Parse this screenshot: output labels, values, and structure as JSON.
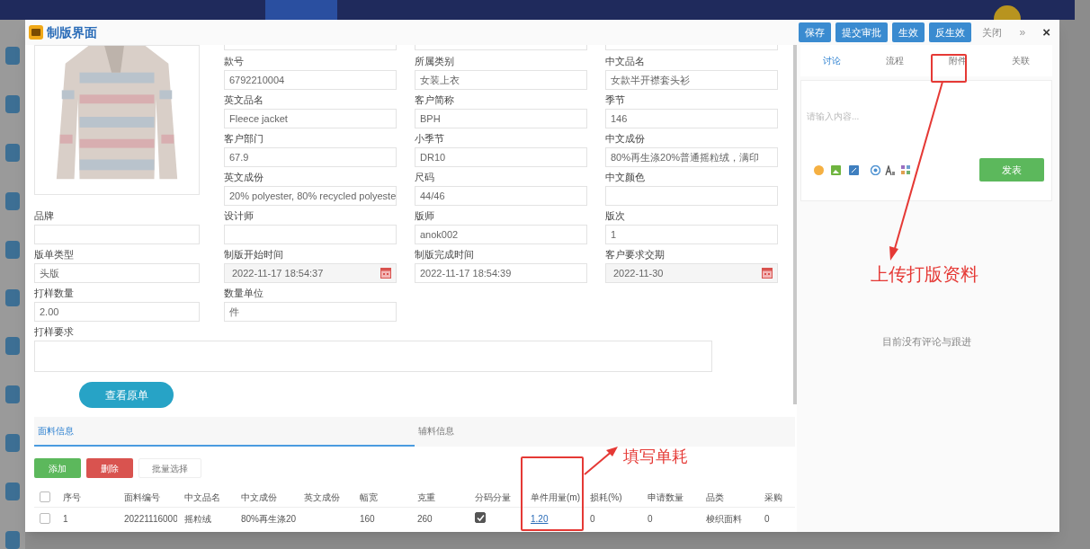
{
  "window": {
    "title": "制版界面"
  },
  "toolbar": {
    "buttons": [
      {
        "label": "保存",
        "kind": "primary"
      },
      {
        "label": "提交审批",
        "kind": "primary"
      },
      {
        "label": "生效",
        "kind": "primary"
      },
      {
        "label": "反生效",
        "kind": "primary"
      },
      {
        "label": "关闭",
        "kind": "plain"
      }
    ],
    "more": "»",
    "close": "×"
  },
  "upper_rows": [
    [
      {
        "label": "款号",
        "value": "6792210004",
        "kind": "text"
      },
      {
        "label": "所属类别",
        "value": "女装上衣",
        "kind": "text"
      },
      {
        "label": "中文品名",
        "value": "女款半开襟套头衫",
        "kind": "text"
      }
    ],
    [
      {
        "label": "英文品名",
        "value": "Fleece jacket",
        "kind": "text"
      },
      {
        "label": "客户简称",
        "value": "BPH",
        "kind": "text"
      },
      {
        "label": "季节",
        "value": "146",
        "kind": "text"
      }
    ],
    [
      {
        "label": "客户部门",
        "value": "67.9",
        "kind": "text"
      },
      {
        "label": "小季节",
        "value": "DR10",
        "kind": "text"
      },
      {
        "label": "中文成份",
        "value": "80%再生涤20%普通摇粒绒，满印",
        "kind": "text"
      }
    ],
    [
      {
        "label": "英文成份",
        "value": "20% polyester, 80% recycled polyeste",
        "kind": "text"
      },
      {
        "label": "尺码",
        "value": "44/46",
        "kind": "text"
      },
      {
        "label": "中文颜色",
        "kind": "text"
      }
    ]
  ],
  "lower_rows": [
    [
      {
        "label": "品牌",
        "kind": "text"
      },
      {
        "label": "设计师",
        "kind": "text"
      },
      {
        "label": "版师",
        "value": "anok002",
        "kind": "text"
      },
      {
        "label": "版次",
        "value": "1",
        "kind": "text"
      }
    ],
    [
      {
        "label": "版单类型",
        "value": "头版",
        "kind": "text"
      },
      {
        "label": "制版开始时间",
        "value": "2022-11-17 18:54:37",
        "kind": "date"
      },
      {
        "label": "制版完成时间",
        "value": "2022-11-17 18:54:39",
        "kind": "text"
      },
      {
        "label": "客户要求交期",
        "value": "2022-11-30",
        "kind": "date"
      }
    ],
    [
      {
        "label": "打样数量",
        "value": "2.00",
        "kind": "text"
      },
      {
        "label": "数量单位",
        "value": "件",
        "kind": "text"
      }
    ]
  ],
  "sample_requirements": {
    "label": "打样要求"
  },
  "view_order_button": "查看原单",
  "material_tabs": [
    {
      "label": "面料信息",
      "selected": true
    },
    {
      "label": "辅料信息",
      "selected": false
    }
  ],
  "table_actions": [
    {
      "label": "添加",
      "kind": "add"
    },
    {
      "label": "删除",
      "kind": "delete"
    },
    {
      "label": "批量选择",
      "kind": "plain"
    }
  ],
  "table": {
    "all_checked": false,
    "columns": [
      "序号",
      "面料编号",
      "中文品名",
      "中文成份",
      "英文成份",
      "幅宽",
      "克重",
      "分码分量",
      "单件用量(m)",
      "损耗(%)",
      "申请数量",
      "品类",
      "采购"
    ],
    "rows": [
      {
        "selected": false,
        "cells": [
          {
            "kind": "text",
            "text": "1"
          },
          {
            "kind": "text",
            "text": "20221116000"
          },
          {
            "kind": "text",
            "text": "摇粒绒"
          },
          {
            "kind": "text",
            "text": "80%再生涤20"
          },
          {
            "kind": "empty"
          },
          {
            "kind": "text",
            "text": "160"
          },
          {
            "kind": "text",
            "text": "260"
          },
          {
            "kind": "checkbox",
            "checked": true
          },
          {
            "kind": "link",
            "text": "1.20"
          },
          {
            "kind": "text",
            "text": "0"
          },
          {
            "kind": "text",
            "text": "0"
          },
          {
            "kind": "text",
            "text": "梭织面料"
          },
          {
            "kind": "text",
            "text": "0"
          }
        ]
      }
    ]
  },
  "side_panel": {
    "tabs": [
      {
        "label": "讨论",
        "selected": true
      },
      {
        "label": "流程",
        "selected": false
      },
      {
        "label": "附件",
        "selected": false
      },
      {
        "label": "关联",
        "selected": false
      }
    ],
    "comment_box": {
      "placeholder": "请输入内容..."
    },
    "post_button": "发表",
    "empty_text": "目前没有评论与跟进"
  },
  "annotations": [
    {
      "text": "上传打版资料"
    },
    {
      "text": "填写单耗"
    }
  ]
}
